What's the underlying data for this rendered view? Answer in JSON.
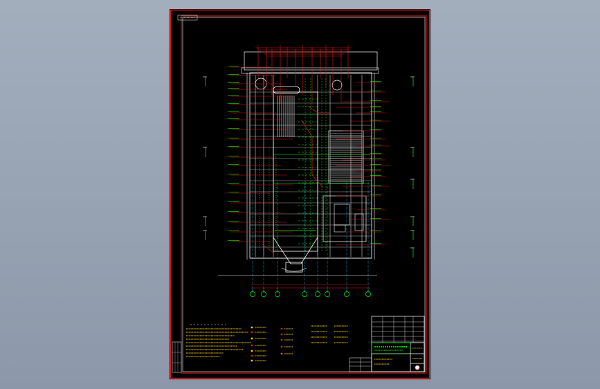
{
  "viewer": {
    "background_top": "#a3aebd",
    "background_bottom": "#8c98a9"
  },
  "drawing": {
    "sheet_background": "#000000",
    "border_color": "#e21b1b",
    "line_color": "#ffffff",
    "pipe_color": "#e21b1b",
    "steel_color": "#00ff00",
    "axis_color": "#00d0ff",
    "note_color": "#ffd200",
    "drawing_number": "",
    "sheet_title": ""
  }
}
